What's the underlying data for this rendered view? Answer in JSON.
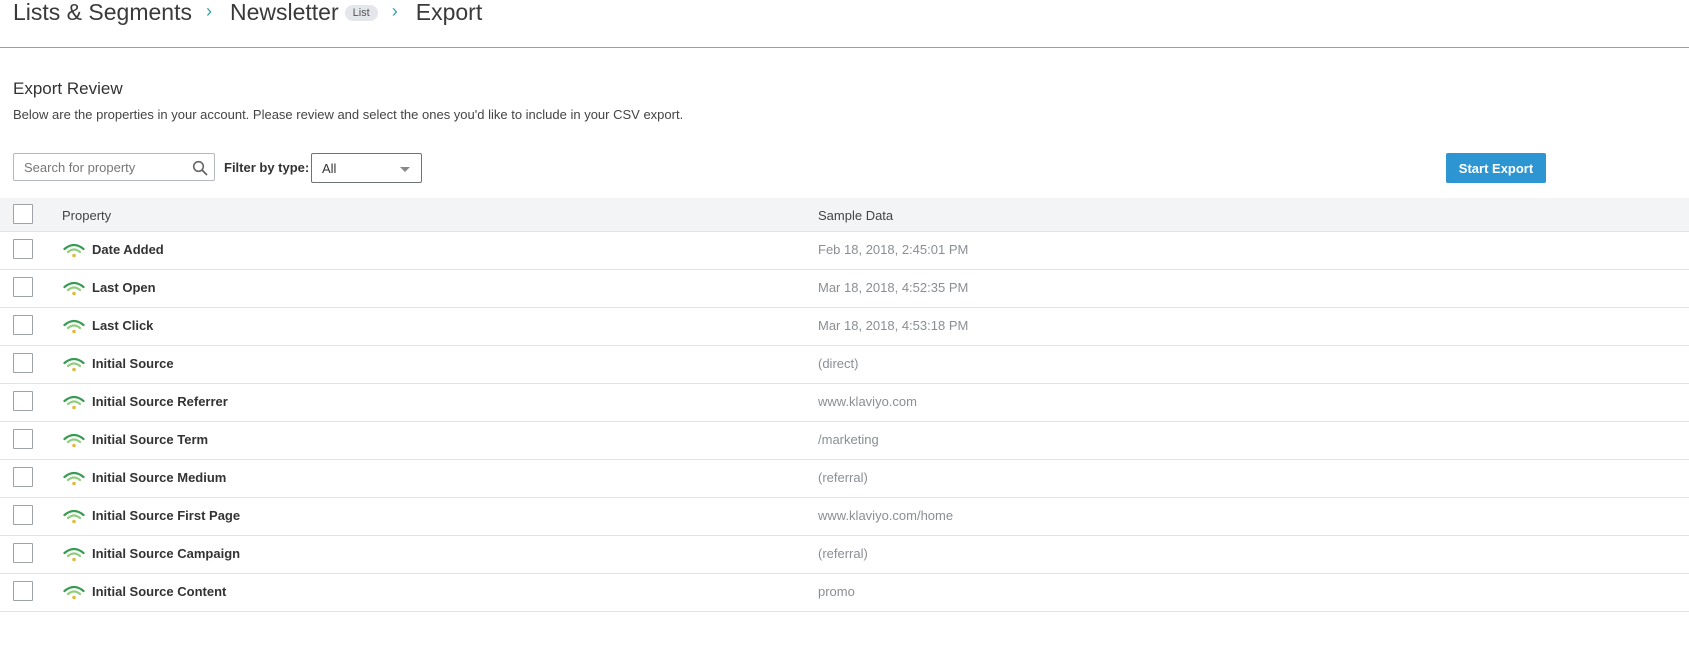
{
  "breadcrumb": {
    "items": [
      "Lists & Segments",
      "Newsletter",
      "Export"
    ],
    "badge": "List",
    "separator": "›"
  },
  "section": {
    "title": "Export Review",
    "description": "Below are the properties in your account. Please review and select the ones you'd like to include in your CSV export."
  },
  "toolbar": {
    "search_placeholder": "Search for property",
    "search_value": "",
    "filter_label": "Filter by type:",
    "filter_value": "All",
    "start_export_label": "Start Export"
  },
  "table": {
    "columns": [
      "Property",
      "Sample Data"
    ],
    "rows": [
      {
        "property": "Date Added",
        "sample": "Feb 18, 2018, 2:45:01 PM",
        "icon": "signal-icon"
      },
      {
        "property": "Last Open",
        "sample": "Mar 18, 2018, 4:52:35 PM",
        "icon": "signal-icon"
      },
      {
        "property": "Last Click",
        "sample": "Mar 18, 2018, 4:53:18 PM",
        "icon": "signal-icon"
      },
      {
        "property": "Initial Source",
        "sample": "(direct)",
        "icon": "signal-icon"
      },
      {
        "property": "Initial Source Referrer",
        "sample": "www.klaviyo.com",
        "icon": "signal-icon"
      },
      {
        "property": "Initial Source Term",
        "sample": "/marketing",
        "icon": "signal-icon"
      },
      {
        "property": "Initial Source Medium",
        "sample": "(referral)",
        "icon": "signal-icon"
      },
      {
        "property": "Initial Source First Page",
        "sample": "www.klaviyo.com/home",
        "icon": "signal-icon"
      },
      {
        "property": "Initial Source Campaign",
        "sample": "(referral)",
        "icon": "signal-icon"
      },
      {
        "property": "Initial Source Content",
        "sample": "promo",
        "icon": "signal-icon"
      }
    ]
  },
  "colors": {
    "accent": "#2d96d2",
    "separator": "#2ea3a3",
    "signal_dark": "#3a9b54",
    "signal_light": "#8fce7a",
    "signal_dot": "#e2b93b"
  }
}
